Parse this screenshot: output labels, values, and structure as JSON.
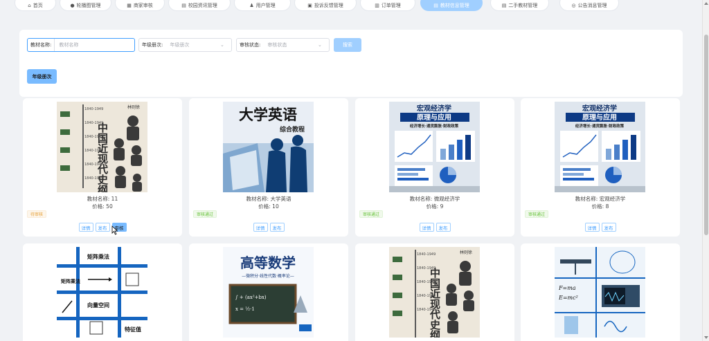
{
  "nav": [
    {
      "label": "首页",
      "icon": "home-icon"
    },
    {
      "label": "轮播图管理",
      "icon": "image-icon"
    },
    {
      "label": "商家审核",
      "icon": "shop-icon"
    },
    {
      "label": "校园资讯管理",
      "icon": "news-icon"
    },
    {
      "label": "用户管理",
      "icon": "user-icon"
    },
    {
      "label": "投诉反馈管理",
      "icon": "feedback-icon"
    },
    {
      "label": "订单管理",
      "icon": "order-icon"
    },
    {
      "label": "教材信息管理",
      "icon": "book-icon",
      "active": true
    },
    {
      "label": "二手教材管理",
      "icon": "book-icon"
    },
    {
      "label": "公告消息管理",
      "icon": "bell-icon"
    }
  ],
  "search": {
    "name_label": "教材名称:",
    "name_placeholder": "教材名称",
    "grade_label": "年级册次:",
    "grade_placeholder": "年级册次",
    "status_label": "审核状态:",
    "status_placeholder": "审核状态",
    "search_button": "搜索",
    "grade_button": "年级册次"
  },
  "cards": [
    {
      "name_label": "教材名称: 11",
      "price_label": "价格: 50",
      "status": "待审核",
      "status_kind": "pending",
      "actions": [
        "详情",
        "发布",
        "审核"
      ],
      "cover": "history"
    },
    {
      "name_label": "教材名称: 大学英语",
      "price_label": "价格: 10",
      "status": "审核通过",
      "status_kind": "passed",
      "actions": [
        "详情",
        "发布"
      ],
      "cover": "english"
    },
    {
      "name_label": "教材名称: 微观经济学",
      "price_label": "价格: 9",
      "status": "审核通过",
      "status_kind": "passed",
      "actions": [
        "详情",
        "发布"
      ],
      "cover": "econ"
    },
    {
      "name_label": "教材名称: 宏观经济学",
      "price_label": "价格: 8",
      "status": "审核通过",
      "status_kind": "passed",
      "actions": [
        "详情",
        "发布"
      ],
      "cover": "econ"
    },
    {
      "cover": "matrix"
    },
    {
      "cover": "math"
    },
    {
      "cover": "history"
    },
    {
      "cover": "physics"
    }
  ],
  "cover_text": {
    "history_title": "中国近现代史纲要",
    "history_author": "林则徐",
    "english_title": "大学英语",
    "english_sub": "综合教程",
    "econ_title_1": "宏观经济学",
    "econ_title_2": "原理与应用",
    "econ_sub": "经济增长·通货膨胀·财政政策",
    "math_title": "高等数学",
    "math_sub": "—微积分·线性代数·概率论—",
    "matrix_1": "矩阵乘法",
    "matrix_2": "矩阵乘法",
    "matrix_3": "向量空间",
    "matrix_4": "特征值",
    "physics_1": "F=ma",
    "physics_2": "E=mc²"
  },
  "colors": {
    "primary": "#409eff",
    "primary_light": "#a0cfff",
    "pending": "#e6a23c",
    "passed": "#67c23a"
  }
}
